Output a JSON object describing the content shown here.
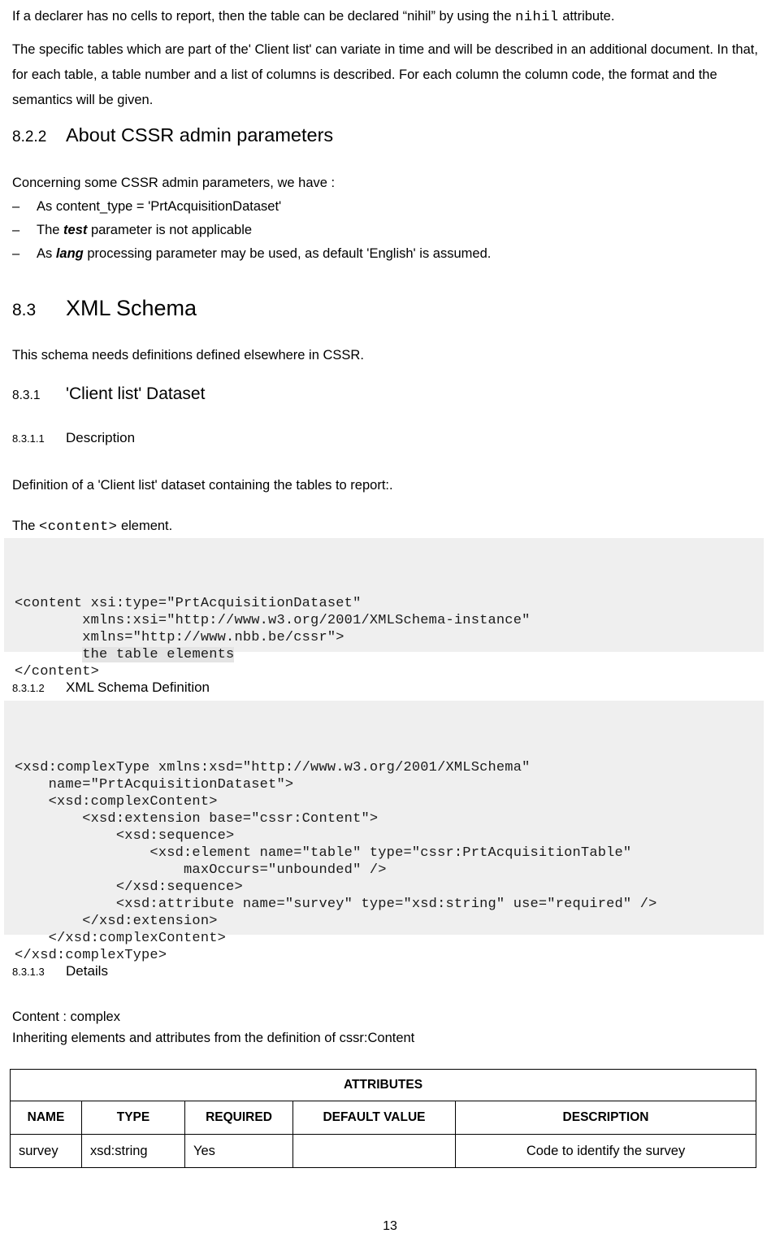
{
  "document": {
    "page_number": "13"
  },
  "intro": {
    "line1_before": "If a declarer has no cells to report, then the table can be declared “nihil” by using the ",
    "line1_code": "nihil",
    "line1_after": " attribute.",
    "paragraph2": "The specific tables which are part of the' Client list' can variate in time and will be described in an additional document. In that, for each table, a table number and a list of columns is described. For each column the column code, the format and the semantics will be given."
  },
  "section_8_2_2": {
    "number": "8.2.2",
    "title": "About CSSR admin parameters",
    "lead_in": "Concerning some CSSR admin parameters, we have :",
    "bullet_marker": "–",
    "bullets": [
      {
        "prefix": "As content_type = 'PrtAcquisitionDataset'",
        "emphasis": "",
        "suffix": ""
      },
      {
        "prefix": "The ",
        "emphasis": "test",
        "suffix": " parameter is not applicable"
      },
      {
        "prefix": "As ",
        "emphasis": "lang",
        "suffix": " processing parameter may be used, as default 'English' is assumed."
      }
    ]
  },
  "section_8_3": {
    "number": "8.3",
    "title": "XML Schema",
    "intro": "This schema needs definitions defined elsewhere in CSSR."
  },
  "section_8_3_1": {
    "number": "8.3.1",
    "title": "'Client list' Dataset"
  },
  "section_8_3_1_1": {
    "number": "8.3.1.1",
    "title": "Description",
    "definition": "Definition of a 'Client list' dataset containing the tables to report:.",
    "element_line_before": "The ",
    "element_line_code": "<content>",
    "element_line_after": " element.",
    "code_line1": "<content xsi:type=\"PrtAcquisitionDataset\"",
    "code_line2": "        xmlns:xsi=\"http://www.w3.org/2001/XMLSchema-instance\"",
    "code_line3": "        xmlns=\"http://www.nbb.be/cssr\">",
    "code_line4_indent": "        ",
    "code_line4_highlight": "the table elements",
    "code_line5": "</content>"
  },
  "section_8_3_1_2": {
    "number": "8.3.1.2",
    "title": "XML Schema Definition",
    "code": "<xsd:complexType xmlns:xsd=\"http://www.w3.org/2001/XMLSchema\"\n    name=\"PrtAcquisitionDataset\">\n    <xsd:complexContent>\n        <xsd:extension base=\"cssr:Content\">\n            <xsd:sequence>\n                <xsd:element name=\"table\" type=\"cssr:PrtAcquisitionTable\"\n                    maxOccurs=\"unbounded\" />\n            </xsd:sequence>\n            <xsd:attribute name=\"survey\" type=\"xsd:string\" use=\"required\" />\n        </xsd:extension>\n    </xsd:complexContent>\n</xsd:complexType>"
  },
  "section_8_3_1_3": {
    "number": "8.3.1.3",
    "title": "Details",
    "content_line": "Content : complex",
    "inheriting_line": "Inheriting elements and attributes from the definition of cssr:Content"
  },
  "attributes_table": {
    "title": "ATTRIBUTES",
    "columns": [
      "NAME",
      "TYPE",
      "REQUIRED",
      "DEFAULT VALUE",
      "DESCRIPTION"
    ],
    "rows": [
      {
        "name": "survey",
        "type": "xsd:string",
        "required": "Yes",
        "default_value": "",
        "description": "Code to identify the survey"
      }
    ]
  }
}
